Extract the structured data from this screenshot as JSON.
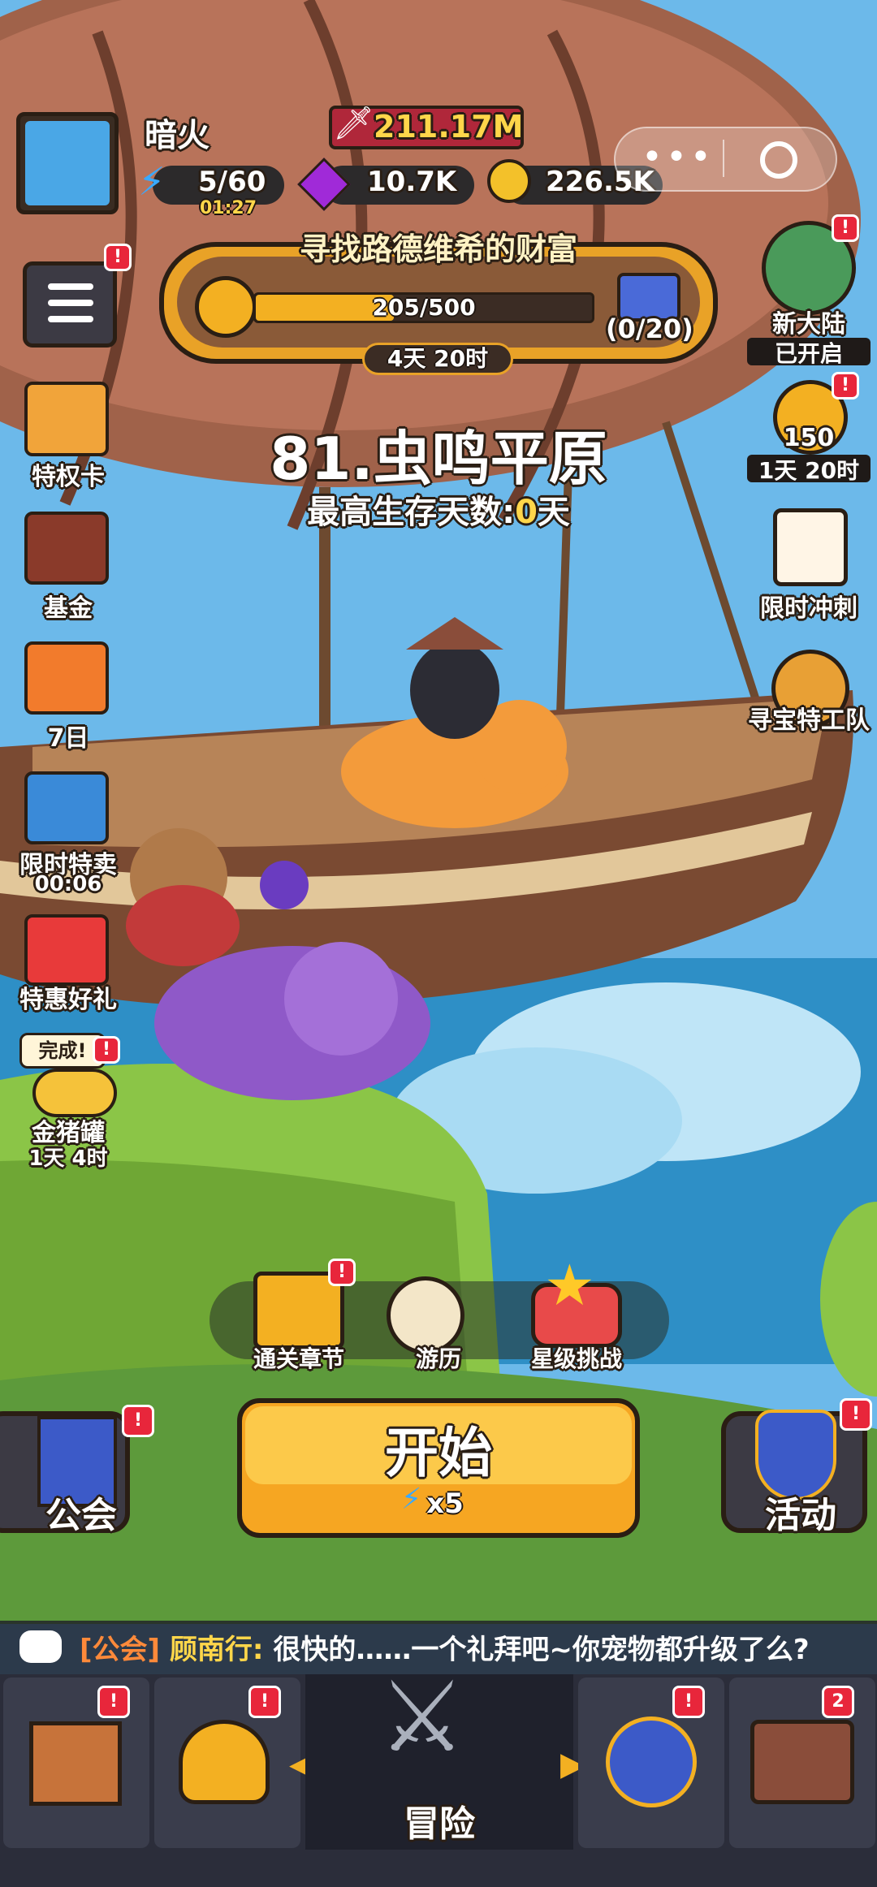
{
  "player": {
    "name": "暗火",
    "power": "211.17M"
  },
  "resources": {
    "energy": "5/60",
    "energy_timer": "01:27",
    "gems": "10.7K",
    "coins": "226.5K"
  },
  "event": {
    "title": "寻找路德维希的财富",
    "progress_text": "205/500",
    "progress_fraction": 0.41,
    "reward_count": "(0/20)",
    "timer": "4天 20时"
  },
  "stage": {
    "title": "81.虫鸣平原",
    "best_label": "最高生存天数:",
    "best_value": "0",
    "best_unit": "天"
  },
  "left_menu": [
    {
      "label": "特权卡"
    },
    {
      "label": "基金"
    },
    {
      "label": "7日"
    },
    {
      "label": "限时特卖",
      "timer": "00:06"
    },
    {
      "label": "特惠好礼"
    },
    {
      "label": "金猪罐",
      "bubble": "完成!",
      "timer": "1天 4时"
    }
  ],
  "right_menu": [
    {
      "label": "新大陆",
      "status": "已开启"
    },
    {
      "count": "150",
      "timer": "1天 20时"
    },
    {
      "label": "限时冲刺"
    },
    {
      "label": "寻宝特工队"
    }
  ],
  "quick_actions": [
    {
      "label": "通关章节"
    },
    {
      "label": "游历"
    },
    {
      "label": "星级挑战"
    }
  ],
  "start": {
    "label": "开始",
    "cost": "x5"
  },
  "guild_button": {
    "label": "公会"
  },
  "activity_button": {
    "label": "活动"
  },
  "chat": {
    "channel": "[公会]",
    "sender": "顾南行:",
    "message": "很快的……一个礼拜吧~你宠物都升级了么?"
  },
  "nav": {
    "center_label": "冒险",
    "badge_count": "2"
  },
  "badge_mark": "!",
  "colors": {
    "accent": "#f6a622",
    "badge": "#e8263b",
    "highlight": "#ffd64a"
  }
}
